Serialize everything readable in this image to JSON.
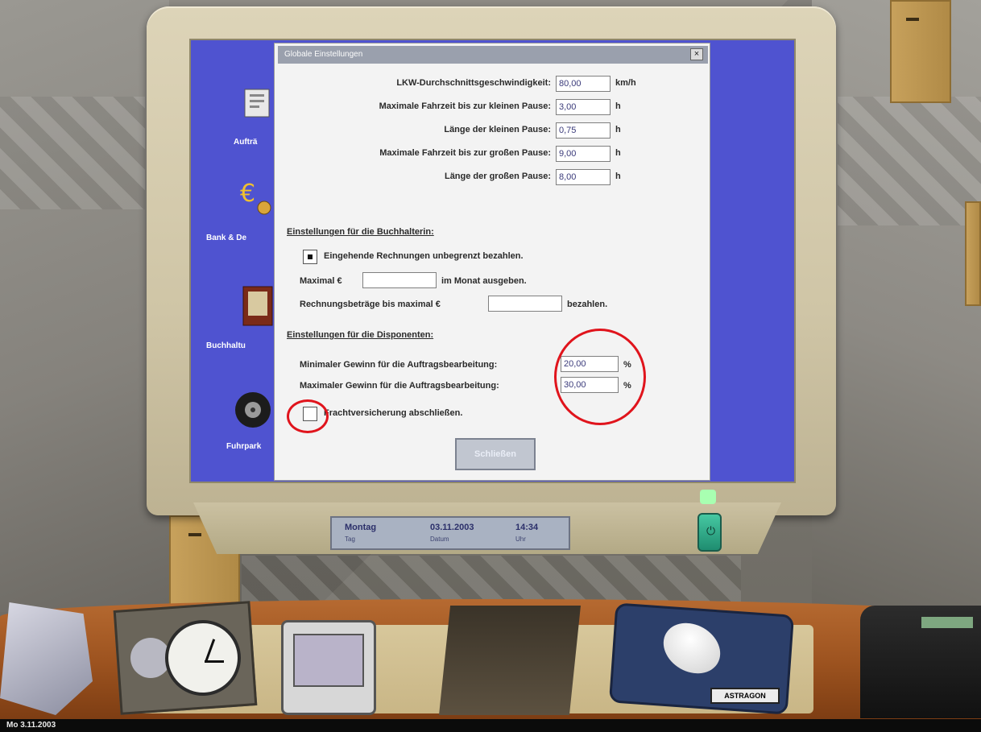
{
  "window": {
    "title": "Globale Einstellungen",
    "close_glyph": "×"
  },
  "sidebar": {
    "items": [
      {
        "label": "Aufträ",
        "icon": "document-icon"
      },
      {
        "label": "Bank & De",
        "icon": "euro-icon"
      },
      {
        "label": "Buchhaltu",
        "icon": "books-icon"
      },
      {
        "label": "Fuhrpark",
        "icon": "tire-icon"
      }
    ]
  },
  "driving": {
    "rows": [
      {
        "label": "LKW-Durchschnittsgeschwindigkeit:",
        "value": "80,00",
        "unit": "km/h"
      },
      {
        "label": "Maximale Fahrzeit bis zur kleinen Pause:",
        "value": "3,00",
        "unit": "h"
      },
      {
        "label": "Länge der kleinen Pause:",
        "value": "0,75",
        "unit": "h"
      },
      {
        "label": "Maximale Fahrzeit bis zur großen Pause:",
        "value": "9,00",
        "unit": "h"
      },
      {
        "label": "Länge der großen Pause:",
        "value": "8,00",
        "unit": "h"
      }
    ]
  },
  "accounting": {
    "heading": "Einstellungen für die Buchhalterin:",
    "pay_unlimited_label": "Eingehende Rechnungen unbegrenzt bezahlen.",
    "pay_unlimited_checked": true,
    "max_per_month_prefix": "Maximal €",
    "max_per_month_value": "",
    "max_per_month_suffix": "im Monat ausgeben.",
    "invoice_max_prefix": "Rechnungsbeträge bis maximal €",
    "invoice_max_value": "",
    "invoice_max_suffix": "bezahlen."
  },
  "dispatch": {
    "heading": "Einstellungen für die Disponenten:",
    "min_profit_label": "Minimaler Gewinn für die Auftragsbearbeitung:",
    "min_profit_value": "20,00",
    "max_profit_label": "Maximaler Gewinn für die Auftragsbearbeitung:",
    "max_profit_value": "30,00",
    "percent_unit": "%",
    "insurance_label": "Frachtversicherung abschließen.",
    "insurance_checked": false
  },
  "buttons": {
    "close_label": "Schließen"
  },
  "monitor_status": {
    "day": "Montag",
    "day_sub": "Tag",
    "date": "03.11.2003",
    "date_sub": "Datum",
    "time": "14:34",
    "time_sub": "Uhr"
  },
  "desk": {
    "mousepad_brand": "ASTRAGON"
  },
  "taskbar": {
    "date": "Mo 3.11.2003"
  },
  "colors": {
    "screen_bg": "#4f53d0",
    "highlight_red": "#e0141c"
  }
}
